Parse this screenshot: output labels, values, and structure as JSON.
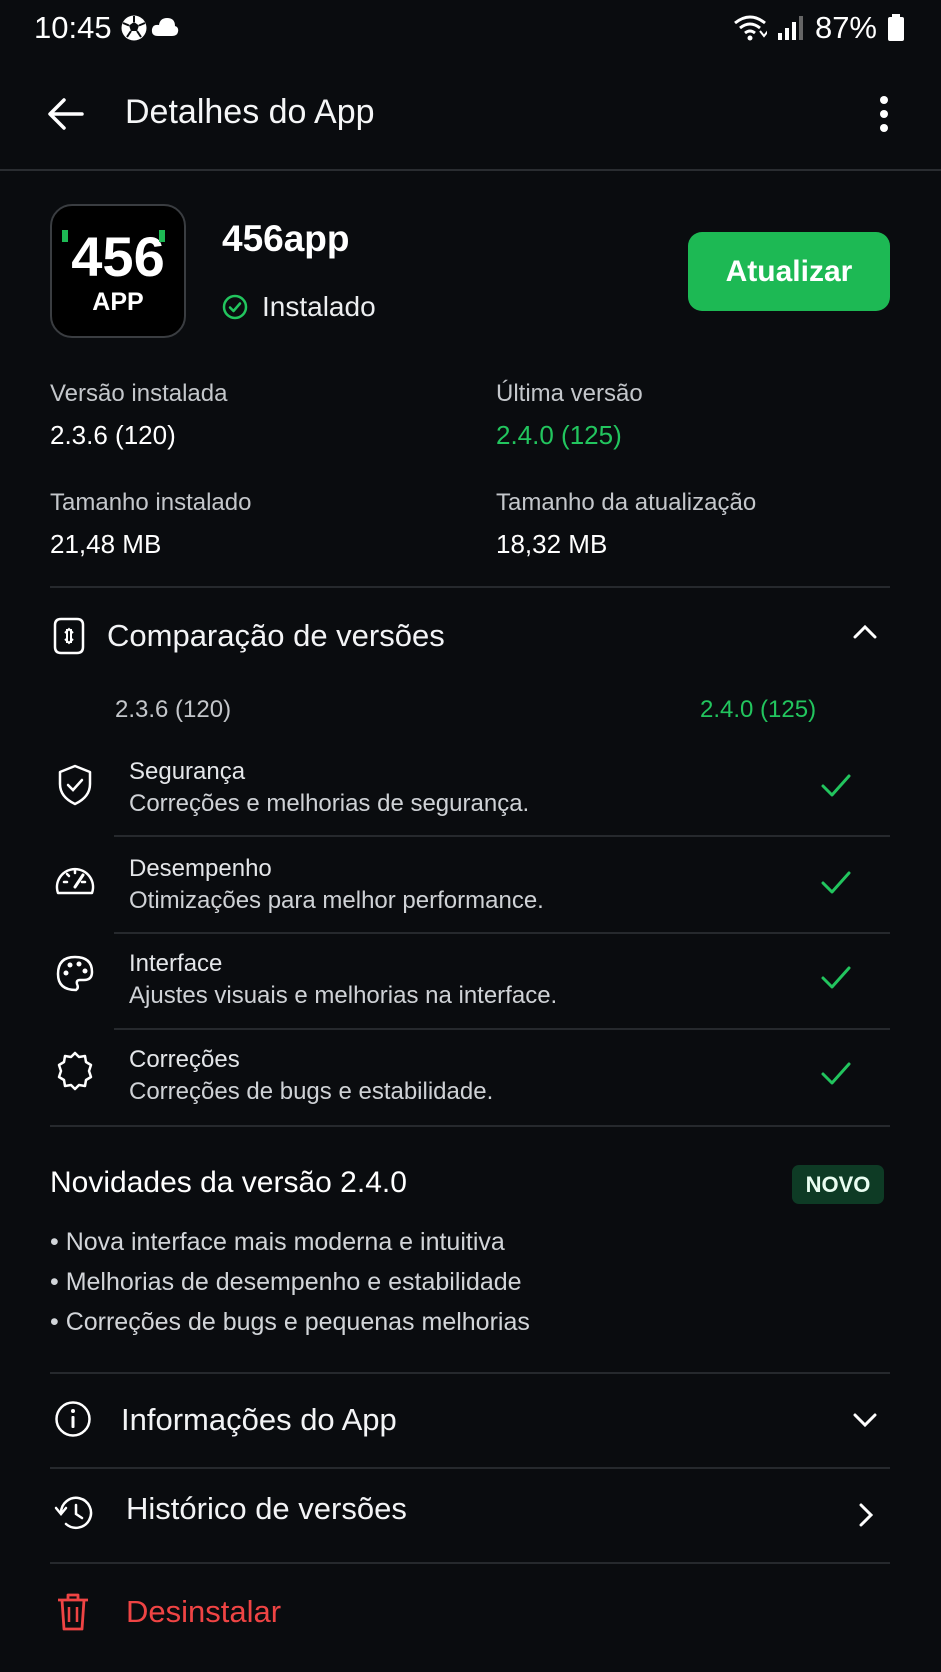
{
  "status_bar": {
    "time": "10:45",
    "battery": "87%"
  },
  "appbar": {
    "title": "Detalhes do App",
    "back_icon": "arrow-left-icon",
    "menu_icon": "more-vert-icon"
  },
  "app": {
    "icon_text_top": "456",
    "icon_text_bottom": "APP",
    "name": "456app",
    "status": "Instalado",
    "update_label": "Atualizar"
  },
  "details": {
    "installed_version_label": "Versão instalada",
    "installed_version": "2.3.6 (120)",
    "latest_version_label": "Última versão",
    "latest_version": "2.4.0 (125)",
    "installed_size_label": "Tamanho instalado",
    "installed_size": "21,48 MB",
    "update_size_label": "Tamanho da atualização",
    "update_size": "18,32 MB"
  },
  "comparison": {
    "title": "Comparação de versões",
    "old_version": "2.3.6 (120)",
    "new_version": "2.4.0 (125)",
    "items": [
      {
        "title": "Segurança",
        "desc": "Correções e melhorias de segurança.",
        "icon": "shield-icon"
      },
      {
        "title": "Desempenho",
        "desc": "Otimizações para melhor performance.",
        "icon": "speedometer-icon"
      },
      {
        "title": "Interface",
        "desc": "Ajustes visuais e melhorias na interface.",
        "icon": "palette-icon"
      },
      {
        "title": "Correções",
        "desc": "Correções de bugs e estabilidade.",
        "icon": "gear-icon"
      }
    ]
  },
  "news": {
    "title": "Novidades da versão 2.4.0",
    "badge": "NOVO",
    "items": [
      "• Nova interface mais moderna e intuitiva",
      "• Melhorias de desempenho e estabilidade",
      "• Correções de bugs e pequenas melhorias"
    ]
  },
  "rows": {
    "info": "Informações do App",
    "history": "Histórico de versões",
    "uninstall": "Desinstalar"
  },
  "colors": {
    "accent": "#1db954",
    "danger": "#ef4444",
    "background": "#0a0c0f"
  }
}
